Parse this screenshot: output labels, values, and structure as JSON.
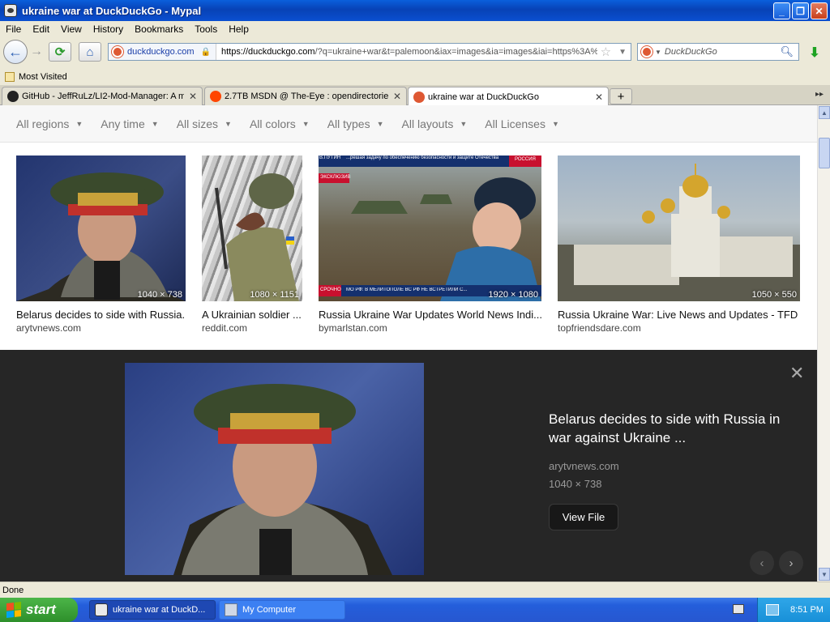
{
  "window": {
    "title": "ukraine war at DuckDuckGo - Mypal",
    "controls": {
      "minimize": "_",
      "maximize": "❐",
      "close": "✕"
    }
  },
  "menu": [
    "File",
    "Edit",
    "View",
    "History",
    "Bookmarks",
    "Tools",
    "Help"
  ],
  "toolbar": {
    "back": "←",
    "forward": "→",
    "reload": "⟳",
    "home": "⌂",
    "identity_host": "duckduckgo.com",
    "url_host": "https://duckduckgo.com",
    "url_rest": "/?q=ukraine+war&t=palemoon&iax=images&ia=images&iai=https%3A%",
    "search_engine_label": "DuckDuckGo",
    "download": "⬇"
  },
  "bookmarks": {
    "most_visited": "Most Visited"
  },
  "tabs": [
    {
      "label": "GitHub - JeffRuLz/LI2-Mod-Manager: A m...",
      "close": "✕"
    },
    {
      "label": "2.7TB MSDN @ The-Eye : opendirectories",
      "close": "✕"
    },
    {
      "label": "ukraine war at DuckDuckGo",
      "close": "✕"
    }
  ],
  "new_tab": "+",
  "filters": [
    "All regions",
    "Any time",
    "All sizes",
    "All colors",
    "All types",
    "All layouts",
    "All Licenses"
  ],
  "results": [
    {
      "caption": "Belarus decides to side with Russia...",
      "source": "arytvnews.com",
      "dims": "1040 × 738"
    },
    {
      "caption": "A Ukrainian soldier ...",
      "source": "reddit.com",
      "dims": "1080 × 1151"
    },
    {
      "caption": "Russia Ukraine War Updates World News Indi...",
      "source": "bymarlstan.com",
      "dims": "1920 × 1080"
    },
    {
      "caption": "Russia Ukraine War: Live News and Updates - TFD",
      "source": "topfriendsdare.com",
      "dims": "1050 × 550"
    }
  ],
  "tv_overlay": {
    "top_left": "В.ПУТИН",
    "banner": "...решая задачу по обеспечению безопасности и защите Отечества",
    "channel": "РОССИЯ",
    "tag": "ЭКСКЛЮЗИВ",
    "bottom_tag": "СРОЧНО",
    "ticker": "МО РФ: В МЕЛИТОПОЛЕ ВС РФ НЕ ВСТРЕТИЛИ С..."
  },
  "detail": {
    "title": "Belarus decides to side with Russia in war against Ukraine ...",
    "source": "arytvnews.com",
    "dims": "1040 × 738",
    "view_file": "View File",
    "close": "✕",
    "prev": "‹",
    "next": "›"
  },
  "status": "Done",
  "taskbar": {
    "start": "start",
    "tasks": [
      "ukraine war at DuckD...",
      "My Computer"
    ],
    "clock": "8:51 PM"
  },
  "colors": {
    "xp_title_blue": "#0a4fd0",
    "ddg_orange": "#de5833",
    "detail_bg": "#262626",
    "start_green": "#3ea33a"
  }
}
